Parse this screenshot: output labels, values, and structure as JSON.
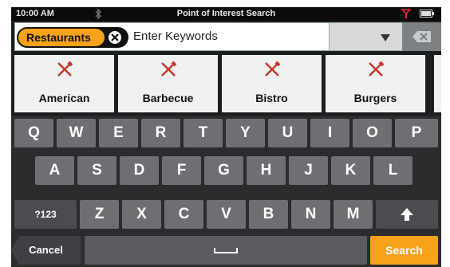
{
  "status_bar": {
    "time": "10:00 AM",
    "title": "Point of Interest Search"
  },
  "search": {
    "category_chip": "Restaurants",
    "placeholder": "Enter Keywords"
  },
  "categories": [
    {
      "label": "American"
    },
    {
      "label": "Barbecue"
    },
    {
      "label": "Bistro"
    },
    {
      "label": "Burgers"
    }
  ],
  "keyboard": {
    "row1": [
      "Q",
      "W",
      "E",
      "R",
      "T",
      "Y",
      "U",
      "I",
      "O",
      "P"
    ],
    "row2": [
      "A",
      "S",
      "D",
      "F",
      "G",
      "H",
      "J",
      "K",
      "L"
    ],
    "row3": [
      "Z",
      "X",
      "C",
      "V",
      "B",
      "N",
      "M"
    ],
    "mode_key": "?123",
    "cancel": "Cancel",
    "search": "Search",
    "space_icon": "space-bar-icon",
    "shift_icon": "shift-up-arrow-icon"
  },
  "colors": {
    "accent": "#f6a21a",
    "background": "#1c1d1f",
    "category_tile": "#f1f1f1",
    "key": "#6d6f72"
  }
}
